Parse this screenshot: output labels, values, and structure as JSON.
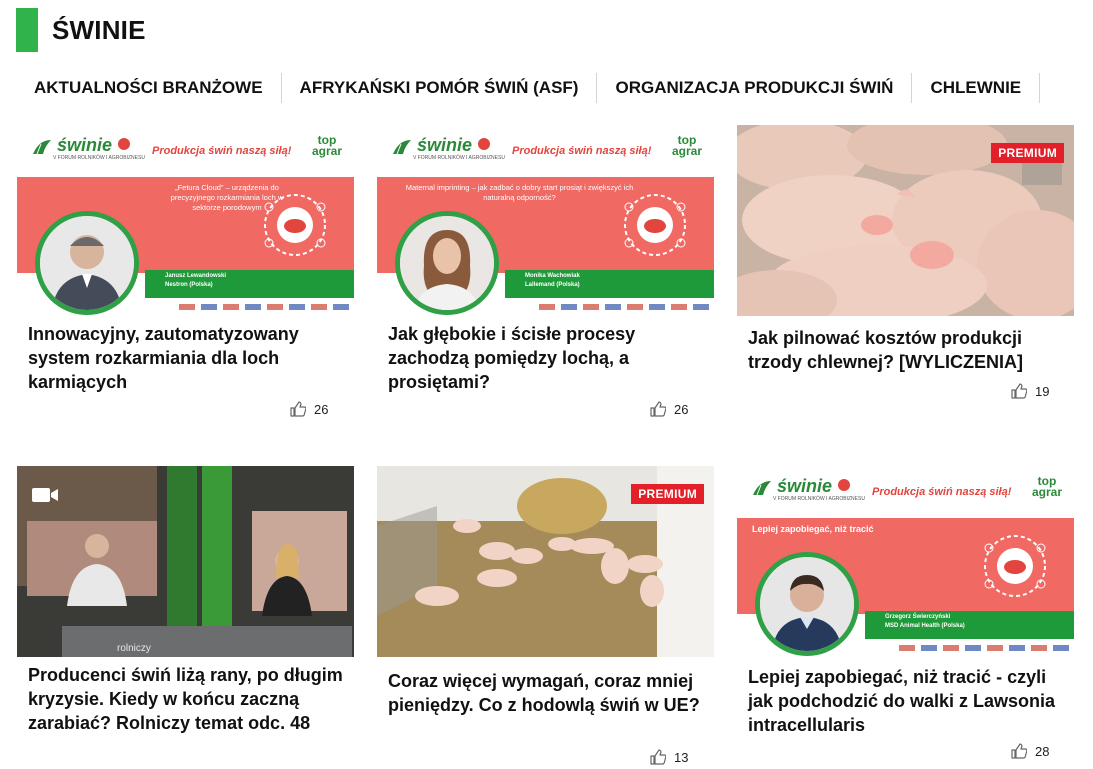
{
  "section": {
    "title": "ŚWINIE"
  },
  "subnav": [
    {
      "label": "AKTUALNOŚCI BRANŻOWE"
    },
    {
      "label": "AFRYKAŃSKI POMÓR ŚWIŃ (ASF)"
    },
    {
      "label": "ORGANIZACJA PRODUKCJI ŚWIŃ"
    },
    {
      "label": "CHLEWNIE"
    }
  ],
  "banner": {
    "logo": "świnie",
    "subtitle": "V FORUM ROLNIKÓW I AGROBIZNESU",
    "slogan": "Produkcja świń naszą siłą!",
    "brand_top": "top",
    "brand_bottom": "agrar",
    "brand_small": "POLSKA"
  },
  "badges": {
    "premium": "PREMIUM"
  },
  "cards": [
    {
      "title": "Innowacyjny, zautomatyzowany system rozkarmiania dla loch karmiących",
      "likes": "26",
      "banner_text": "„Fetura Cloud” – urządzenia do precyzyjnego rozkarmiania loch w sektorze porodowym",
      "speaker": "Janusz Lewandowski",
      "company": "Nestron (Polska)"
    },
    {
      "title": "Jak głębokie i ścisłe procesy zachodzą pomiędzy lochą, a prosiętami?",
      "likes": "26",
      "banner_text": "Maternal imprinting – jak zadbać o dobry start prosiąt i zwiększyć ich naturalną odporność?",
      "speaker": "Monika Wachowiak",
      "company": "Lallemand (Polska)"
    },
    {
      "title": "Jak pilnować kosztów produkcji trzody chlewnej? [WYLICZENIA]",
      "likes": "19"
    },
    {
      "title": "Producenci świń liżą rany, po długim kryzysie. Kiedy w końcu zaczną zarabiać? Rolniczy temat odc. 48",
      "studio_label": "rolniczy"
    },
    {
      "title": "Coraz więcej wymagań, coraz mniej pieniędzy. Co z hodowlą świń w UE?",
      "likes": "13"
    },
    {
      "title": "Lepiej zapobiegać, niż tracić - czyli jak podchodzić do walki z Lawsonia intracellularis",
      "likes": "28",
      "banner_text": "Lepiej zapobiegać, niż tracić",
      "speaker": "Grzegorz Świerczyński",
      "company": "MSD Animal Health (Polska)"
    }
  ],
  "colors": {
    "accent": "#2fb34a",
    "premium": "#e31f2a",
    "banner_red": "#f06a63",
    "banner_green": "#1e9a3a"
  }
}
